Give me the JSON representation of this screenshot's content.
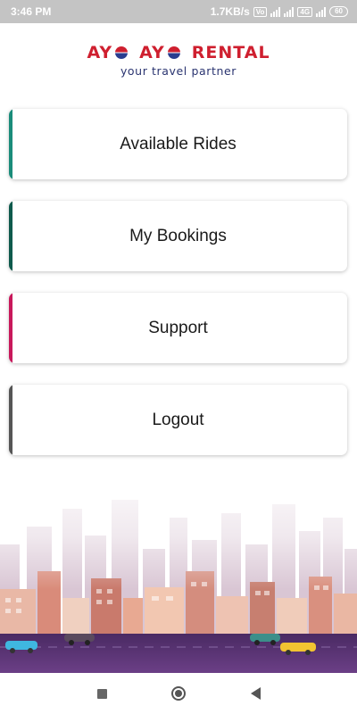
{
  "status_bar": {
    "time": "3:46 PM",
    "network_speed": "1.7KB/s",
    "vo_label": "Vo",
    "lte_label": "4G",
    "battery": "60"
  },
  "header": {
    "logo_part1": "AY",
    "logo_part2": "AY",
    "logo_part3": "RENTAL",
    "tagline": "your travel partner",
    "brand_colors": {
      "red": "#cf1f2f",
      "navy": "#2a3470"
    }
  },
  "menu": [
    {
      "label": "Available Rides",
      "accent": "#1a8c7a"
    },
    {
      "label": "My Bookings",
      "accent": "#0e5a4c"
    },
    {
      "label": "Support",
      "accent": "#c8185b"
    },
    {
      "label": "Logout",
      "accent": "#555555"
    }
  ],
  "navigation": {
    "recents": "square-icon",
    "home": "circle-icon",
    "back": "triangle-back-icon"
  }
}
